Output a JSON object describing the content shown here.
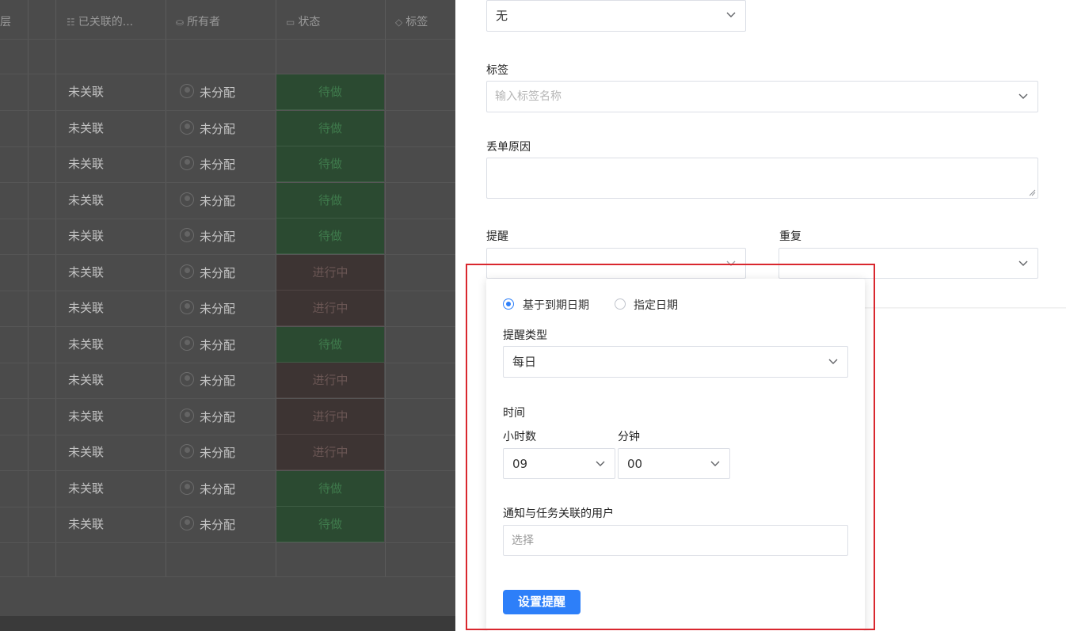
{
  "table": {
    "headers": [
      {
        "icon": "",
        "label": "层"
      },
      {
        "icon": "list-icon",
        "label": "已关联的..."
      },
      {
        "icon": "owner-icon",
        "label": "所有者"
      },
      {
        "icon": "status-icon",
        "label": "状态"
      },
      {
        "icon": "tag-icon",
        "label": "标签"
      }
    ],
    "rows": [
      {
        "link": "未关联",
        "owner": "未分配",
        "status": "待做",
        "status_type": "todo"
      },
      {
        "link": "未关联",
        "owner": "未分配",
        "status": "待做",
        "status_type": "todo"
      },
      {
        "link": "未关联",
        "owner": "未分配",
        "status": "待做",
        "status_type": "todo"
      },
      {
        "link": "未关联",
        "owner": "未分配",
        "status": "待做",
        "status_type": "todo"
      },
      {
        "link": "未关联",
        "owner": "未分配",
        "status": "待做",
        "status_type": "todo"
      },
      {
        "link": "未关联",
        "owner": "未分配",
        "status": "进行中",
        "status_type": "progress"
      },
      {
        "link": "未关联",
        "owner": "未分配",
        "status": "进行中",
        "status_type": "progress"
      },
      {
        "link": "未关联",
        "owner": "未分配",
        "status": "待做",
        "status_type": "todo"
      },
      {
        "link": "未关联",
        "owner": "未分配",
        "status": "进行中",
        "status_type": "progress"
      },
      {
        "link": "未关联",
        "owner": "未分配",
        "status": "进行中",
        "status_type": "progress"
      },
      {
        "link": "未关联",
        "owner": "未分配",
        "status": "进行中",
        "status_type": "progress"
      },
      {
        "link": "未关联",
        "owner": "未分配",
        "status": "待做",
        "status_type": "todo"
      },
      {
        "link": "未关联",
        "owner": "未分配",
        "status": "待做",
        "status_type": "todo"
      }
    ]
  },
  "form": {
    "top_select_value": "无",
    "tags_label": "标签",
    "tags_placeholder": "输入标签名称",
    "lost_reason_label": "丢单原因",
    "reminder_label": "提醒",
    "repeat_label": "重复"
  },
  "popover": {
    "radio_due": "基于到期日期",
    "radio_due_selected": true,
    "radio_specific": "指定日期",
    "type_label": "提醒类型",
    "type_value": "每日",
    "time_label": "时间",
    "hours_label": "小时数",
    "hours_value": "09",
    "minutes_label": "分钟",
    "minutes_value": "00",
    "notify_label": "通知与任务关联的用户",
    "notify_placeholder": "选择",
    "submit_label": "设置提醒"
  },
  "colors": {
    "accent": "#2d7ff9",
    "highlight": "#d9272e",
    "status_todo_bg": "#2b4a31",
    "status_progress_bg": "#3d3433"
  }
}
